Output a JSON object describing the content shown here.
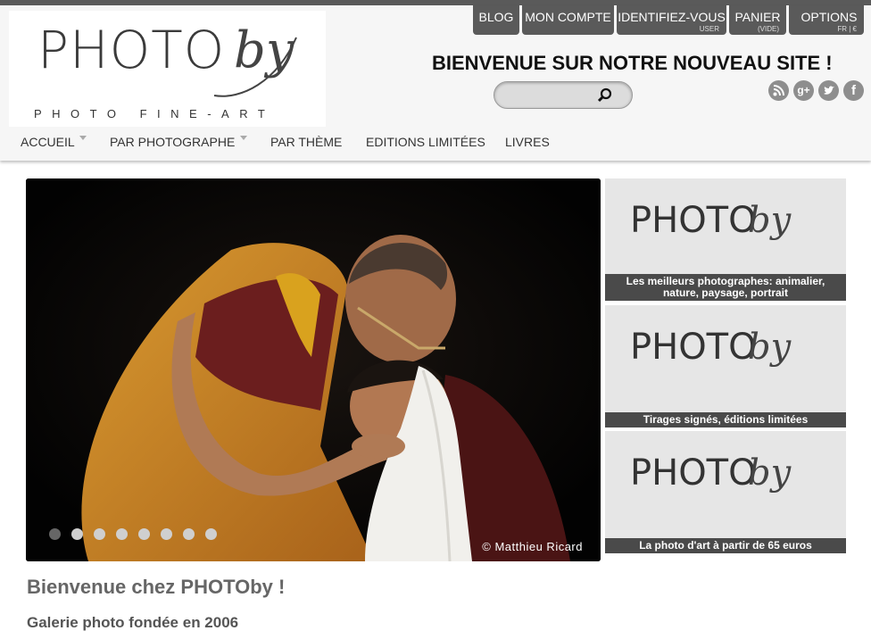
{
  "logo": {
    "word": "PHOTO",
    "by": "by",
    "tagline": "PHOTO FINE-ART"
  },
  "topnav": [
    {
      "label": "BLOG",
      "sub": ""
    },
    {
      "label": "MON COMPTE",
      "sub": ""
    },
    {
      "label": "IDENTIFIEZ-VOUS",
      "sub": "USER"
    },
    {
      "label": "PANIER",
      "sub": "(VIDE)"
    },
    {
      "label": "OPTIONS",
      "sub": "FR | €"
    }
  ],
  "welcome": "BIENVENUE SUR NOTRE NOUVEAU SITE !",
  "search": {
    "placeholder": "",
    "icon": "magnifier-icon"
  },
  "social": [
    {
      "icon": "rss-icon",
      "glyph": "◉"
    },
    {
      "icon": "google-plus-icon",
      "glyph": "g+"
    },
    {
      "icon": "twitter-icon",
      "glyph": "🐦"
    },
    {
      "icon": "facebook-icon",
      "glyph": "f"
    }
  ],
  "mainnav": [
    {
      "label": "ACCUEIL",
      "dropdown": true
    },
    {
      "label": "PAR PHOTOGRAPHE",
      "dropdown": true
    },
    {
      "label": "PAR THÈME",
      "dropdown": false
    },
    {
      "label": "EDITIONS LIMITÉES",
      "dropdown": false
    },
    {
      "label": "LIVRES",
      "dropdown": false
    }
  ],
  "slider": {
    "credit": "© Matthieu Ricard",
    "slide_count": 8,
    "active_index": 0
  },
  "side_panels": [
    {
      "logo": "PHOTO",
      "by": "by",
      "caption": "Les meilleurs photographes: animalier, nature, paysage, portrait"
    },
    {
      "logo": "PHOTO",
      "by": "by",
      "caption": "Tirages signés, éditions limitées"
    },
    {
      "logo": "PHOTO",
      "by": "by",
      "caption": "La photo d'art à partir de 65 euros"
    }
  ],
  "content": {
    "heading": "Bienvenue chez PHOTOby !",
    "subheading": "Galerie photo fondée en 2006"
  },
  "colors": {
    "dark_tab": "#5a5a5a",
    "caption_bg": "#4a4a4a",
    "panel_bg": "#e6e6e6",
    "robe_orange": "#c8841f",
    "robe_maroon": "#6b1e1e"
  }
}
